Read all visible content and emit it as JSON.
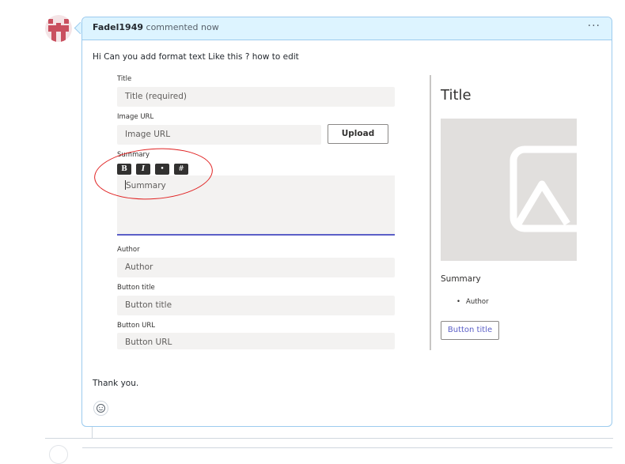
{
  "comment": {
    "author": "Fadel1949",
    "action": "commented now",
    "more_label": "···",
    "body_intro": "Hi Can you add format text Like this ? how to edit",
    "body_outro": "Thank you."
  },
  "form": {
    "title_label": "Title",
    "title_placeholder": "Title (required)",
    "image_label": "Image URL",
    "image_placeholder": "Image URL",
    "upload_label": "Upload",
    "summary_label": "Summary",
    "format_buttons": [
      "B",
      "I",
      "•",
      "#"
    ],
    "summary_placeholder": "Summary",
    "author_label": "Author",
    "author_placeholder": "Author",
    "button_title_label": "Button title",
    "button_title_placeholder": "Button title",
    "button_url_label": "Button URL",
    "button_url_placeholder": "Button URL"
  },
  "preview": {
    "title": "Title",
    "summary": "Summary",
    "author_bullet": "•",
    "author": "Author",
    "button_label": "Button title"
  },
  "colors": {
    "header_bg": "#ddf4ff",
    "header_border": "#9ccbee",
    "accent_underline": "#5b5fc7",
    "annotation": "#e02020"
  },
  "icons": {
    "avatar": "identicon-avatar",
    "image_placeholder": "image-icon",
    "emoji": "smiley-icon"
  }
}
